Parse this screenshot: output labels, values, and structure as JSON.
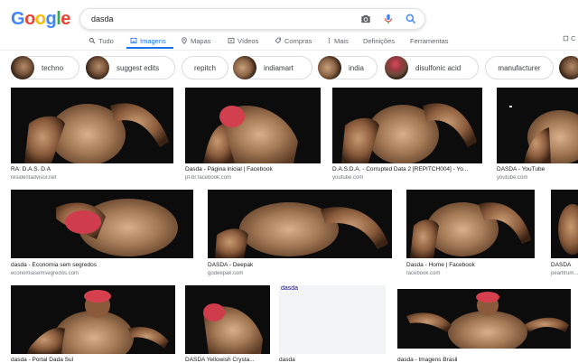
{
  "logo": {
    "letters": [
      "G",
      "o",
      "o",
      "g",
      "l",
      "e"
    ],
    "colors": [
      "#4285F4",
      "#EA4335",
      "#FBBC05",
      "#4285F4",
      "#34A853",
      "#EA4335"
    ]
  },
  "search": {
    "query": "dasda"
  },
  "tabs": [
    {
      "label": "Tudo",
      "icon": "search-icon"
    },
    {
      "label": "Imagens",
      "icon": "image-icon",
      "active": true
    },
    {
      "label": "Mapas",
      "icon": "map-pin-icon"
    },
    {
      "label": "Vídeos",
      "icon": "video-icon"
    },
    {
      "label": "Compras",
      "icon": "tag-icon"
    },
    {
      "label": "Mais",
      "icon": "more-vert-icon"
    },
    {
      "label": "Definições"
    },
    {
      "label": "Ferramentas"
    }
  ],
  "right_tool": "C",
  "chips": [
    "techno",
    "suggest edits",
    "repitch",
    "indiamart",
    "india",
    "disulfonic acid",
    "manufacturer"
  ],
  "results": [
    {
      "caption": "RA: D.A.S. D.A",
      "source": "residentadvisor.net"
    },
    {
      "caption": "Dasda - Página inicial | Facebook",
      "source": "pt-br.facebook.com"
    },
    {
      "caption": "D.A.S.D.A. - Corrupted Data 2 [REPITCH004] - Yo...",
      "source": "youtube.com"
    },
    {
      "caption": "DASDA - YouTube",
      "source": "youtube.com"
    },
    {
      "caption": "dasda - Economia sem segredos",
      "source": "economiasemsegredos.com"
    },
    {
      "caption": "DASDA - Deepak",
      "source": "godeepak.com"
    },
    {
      "caption": "Dasda - Home | Facebook",
      "source": "facebook.com"
    },
    {
      "caption": "DASDA",
      "source": "pearltrum..."
    },
    {
      "caption": "dasda - Portal Dada Sul",
      "source": ""
    },
    {
      "caption": "DASDA Yellowish Crysta...",
      "source": ""
    },
    {
      "caption": "dasda",
      "source": ""
    },
    {
      "caption": "dasda - Imagens Brasil",
      "source": ""
    }
  ],
  "placeholder_link": "dasda"
}
